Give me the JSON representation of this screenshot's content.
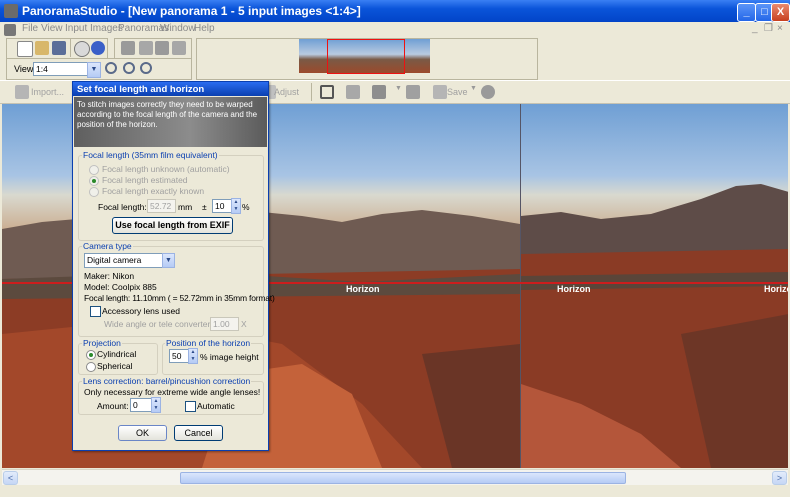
{
  "window": {
    "app_name": "PanoramaStudio",
    "doc_title": " - [New panorama 1 - 5 input images <1:4>]",
    "minimize": "_",
    "maximize": "□",
    "close": "X",
    "mdi_minimize": "_",
    "mdi_restore": "❐",
    "mdi_close": "×"
  },
  "menu": [
    "File",
    "View",
    "Input Images",
    "Panoramas",
    "Window",
    "Help"
  ],
  "toolbar": {
    "view_label": "View:",
    "zoom_value": "1:4",
    "import_label": "Import...",
    "adjust_label": "Adjust",
    "save_label": "Save"
  },
  "canvas": {
    "horizon_labels": [
      "Horizon",
      "Horizon",
      "Horizo"
    ]
  },
  "dialog": {
    "title": "Set focal length and horizon",
    "description": "To stitch images correctly they need to be warped according to the focal length of the camera and the position of the horizon.",
    "focal_group": {
      "label": "Focal length (35mm film equivalent)",
      "options": [
        "Focal length unknown (automatic)",
        "Focal length estimated",
        "Focal length exactly known"
      ],
      "focal_label": "Focal length:",
      "focal_value": "52.72",
      "focal_unit": "mm",
      "plusminus": "±",
      "tolerance_value": "10",
      "percent": "%",
      "exif_button": "Use focal length from EXIF"
    },
    "camera_group": {
      "label": "Camera type",
      "selected": "Digital camera",
      "maker": "Maker: Nikon",
      "model": "Model: Coolpix 885",
      "focal_info": "Focal length: 11.10mm ( = 52.72mm in 35mm format)",
      "accessory_label": "Accessory lens used",
      "converter_label": "Wide angle or tele converter",
      "converter_value": "1.00",
      "converter_unit": "X"
    },
    "projection_group": {
      "label": "Projection",
      "options": [
        "Cylindrical",
        "Spherical"
      ]
    },
    "horizon_group": {
      "label": "Position of the horizon",
      "value": "50",
      "unit": "% image height"
    },
    "lens_group": {
      "label": "Lens correction: barrel/pincushion correction",
      "note": "Only necessary for extreme wide angle lenses!",
      "amount_label": "Amount:",
      "amount_value": "0",
      "automatic_label": "Automatic"
    },
    "ok_label": "OK",
    "cancel_label": "Cancel"
  },
  "scrollbar": {
    "left_arrow": "<",
    "right_arrow": ">"
  }
}
